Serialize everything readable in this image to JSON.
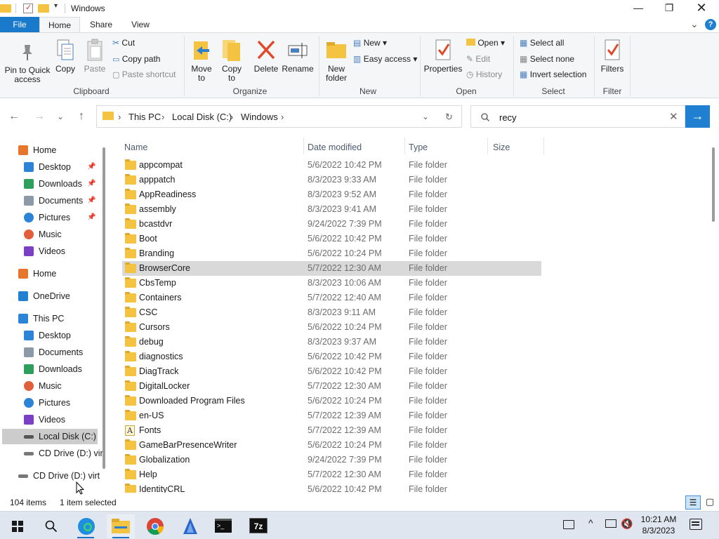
{
  "window": {
    "title": "Windows"
  },
  "tabs": [
    {
      "label": "File"
    },
    {
      "label": "Home"
    },
    {
      "label": "Share"
    },
    {
      "label": "View"
    }
  ],
  "ribbon": {
    "clipboard": {
      "pin": "Pin to Quick access",
      "copy": "Copy",
      "paste": "Paste",
      "cut": "Cut",
      "copy_path": "Copy path",
      "paste_shortcut": "Paste shortcut",
      "group": "Clipboard"
    },
    "organize": {
      "move_to": "Move to",
      "copy_to": "Copy to",
      "delete": "Delete",
      "rename": "Rename",
      "group": "Organize"
    },
    "new": {
      "new_folder": "New folder",
      "new_item": "New",
      "easy_access": "Easy access",
      "group": "New"
    },
    "open": {
      "properties": "Properties",
      "open": "Open",
      "edit": "Edit",
      "history": "History",
      "group": "Open"
    },
    "select": {
      "select_all": "Select all",
      "select_none": "Select none",
      "invert": "Invert selection",
      "group": "Select"
    },
    "filter": {
      "filters": "Filters",
      "group": "Filter"
    }
  },
  "address": {
    "crumbs": [
      "This PC",
      "Local Disk (C:)",
      "Windows"
    ]
  },
  "search": {
    "value": "recy"
  },
  "nav": {
    "items": [
      {
        "label": "Home",
        "icon": "home-icon"
      },
      {
        "label": "Desktop",
        "icon": "desktop-icon",
        "pinned": true
      },
      {
        "label": "Downloads",
        "icon": "download-icon",
        "pinned": true
      },
      {
        "label": "Documents",
        "icon": "documents-icon",
        "pinned": true
      },
      {
        "label": "Pictures",
        "icon": "pictures-icon",
        "pinned": true
      },
      {
        "label": "Music",
        "icon": "music-icon"
      },
      {
        "label": "Videos",
        "icon": "videos-icon"
      },
      {
        "label": "Home",
        "icon": "home-icon"
      },
      {
        "label": "OneDrive",
        "icon": "cloud-icon"
      },
      {
        "label": "This PC",
        "icon": "pc-icon"
      },
      {
        "label": "Desktop",
        "icon": "desktop-icon"
      },
      {
        "label": "Documents",
        "icon": "documents-icon"
      },
      {
        "label": "Downloads",
        "icon": "download-icon"
      },
      {
        "label": "Music",
        "icon": "music-icon"
      },
      {
        "label": "Pictures",
        "icon": "pictures-icon"
      },
      {
        "label": "Videos",
        "icon": "videos-icon"
      },
      {
        "label": "Local Disk (C:)",
        "icon": "drive-icon",
        "selected": true
      },
      {
        "label": "CD Drive (D:) vir",
        "icon": "cd-drive-icon"
      },
      {
        "label": "CD Drive (D:) virt",
        "icon": "cd-drive-icon"
      }
    ]
  },
  "columns": {
    "name": "Name",
    "date": "Date modified",
    "type": "Type",
    "size": "Size"
  },
  "files": [
    {
      "name": "appcompat",
      "date": "5/6/2022 10:42 PM",
      "type": "File folder"
    },
    {
      "name": "apppatch",
      "date": "8/3/2023 9:33 AM",
      "type": "File folder"
    },
    {
      "name": "AppReadiness",
      "date": "8/3/2023 9:52 AM",
      "type": "File folder"
    },
    {
      "name": "assembly",
      "date": "8/3/2023 9:41 AM",
      "type": "File folder"
    },
    {
      "name": "bcastdvr",
      "date": "9/24/2022 7:39 PM",
      "type": "File folder"
    },
    {
      "name": "Boot",
      "date": "5/6/2022 10:42 PM",
      "type": "File folder"
    },
    {
      "name": "Branding",
      "date": "5/6/2022 10:24 PM",
      "type": "File folder"
    },
    {
      "name": "BrowserCore",
      "date": "5/7/2022 12:30 AM",
      "type": "File folder",
      "selected": true
    },
    {
      "name": "CbsTemp",
      "date": "8/3/2023 10:06 AM",
      "type": "File folder"
    },
    {
      "name": "Containers",
      "date": "5/7/2022 12:40 AM",
      "type": "File folder"
    },
    {
      "name": "CSC",
      "date": "8/3/2023 9:11 AM",
      "type": "File folder"
    },
    {
      "name": "Cursors",
      "date": "5/6/2022 10:24 PM",
      "type": "File folder"
    },
    {
      "name": "debug",
      "date": "8/3/2023 9:37 AM",
      "type": "File folder"
    },
    {
      "name": "diagnostics",
      "date": "5/6/2022 10:42 PM",
      "type": "File folder"
    },
    {
      "name": "DiagTrack",
      "date": "5/6/2022 10:42 PM",
      "type": "File folder"
    },
    {
      "name": "DigitalLocker",
      "date": "5/7/2022 12:30 AM",
      "type": "File folder"
    },
    {
      "name": "Downloaded Program Files",
      "date": "5/6/2022 10:24 PM",
      "type": "File folder"
    },
    {
      "name": "en-US",
      "date": "5/7/2022 12:39 AM",
      "type": "File folder"
    },
    {
      "name": "Fonts",
      "date": "5/7/2022 12:39 AM",
      "type": "File folder",
      "icon": "fonts-folder-icon"
    },
    {
      "name": "GameBarPresenceWriter",
      "date": "5/6/2022 10:24 PM",
      "type": "File folder"
    },
    {
      "name": "Globalization",
      "date": "9/24/2022 7:39 PM",
      "type": "File folder"
    },
    {
      "name": "Help",
      "date": "5/7/2022 12:30 AM",
      "type": "File folder"
    },
    {
      "name": "IdentityCRL",
      "date": "5/6/2022 10:42 PM",
      "type": "File folder"
    }
  ],
  "status": {
    "count": "104 items",
    "selected": "1 item selected"
  },
  "clock": {
    "time": "10:21 AM",
    "date": "8/3/2023"
  }
}
